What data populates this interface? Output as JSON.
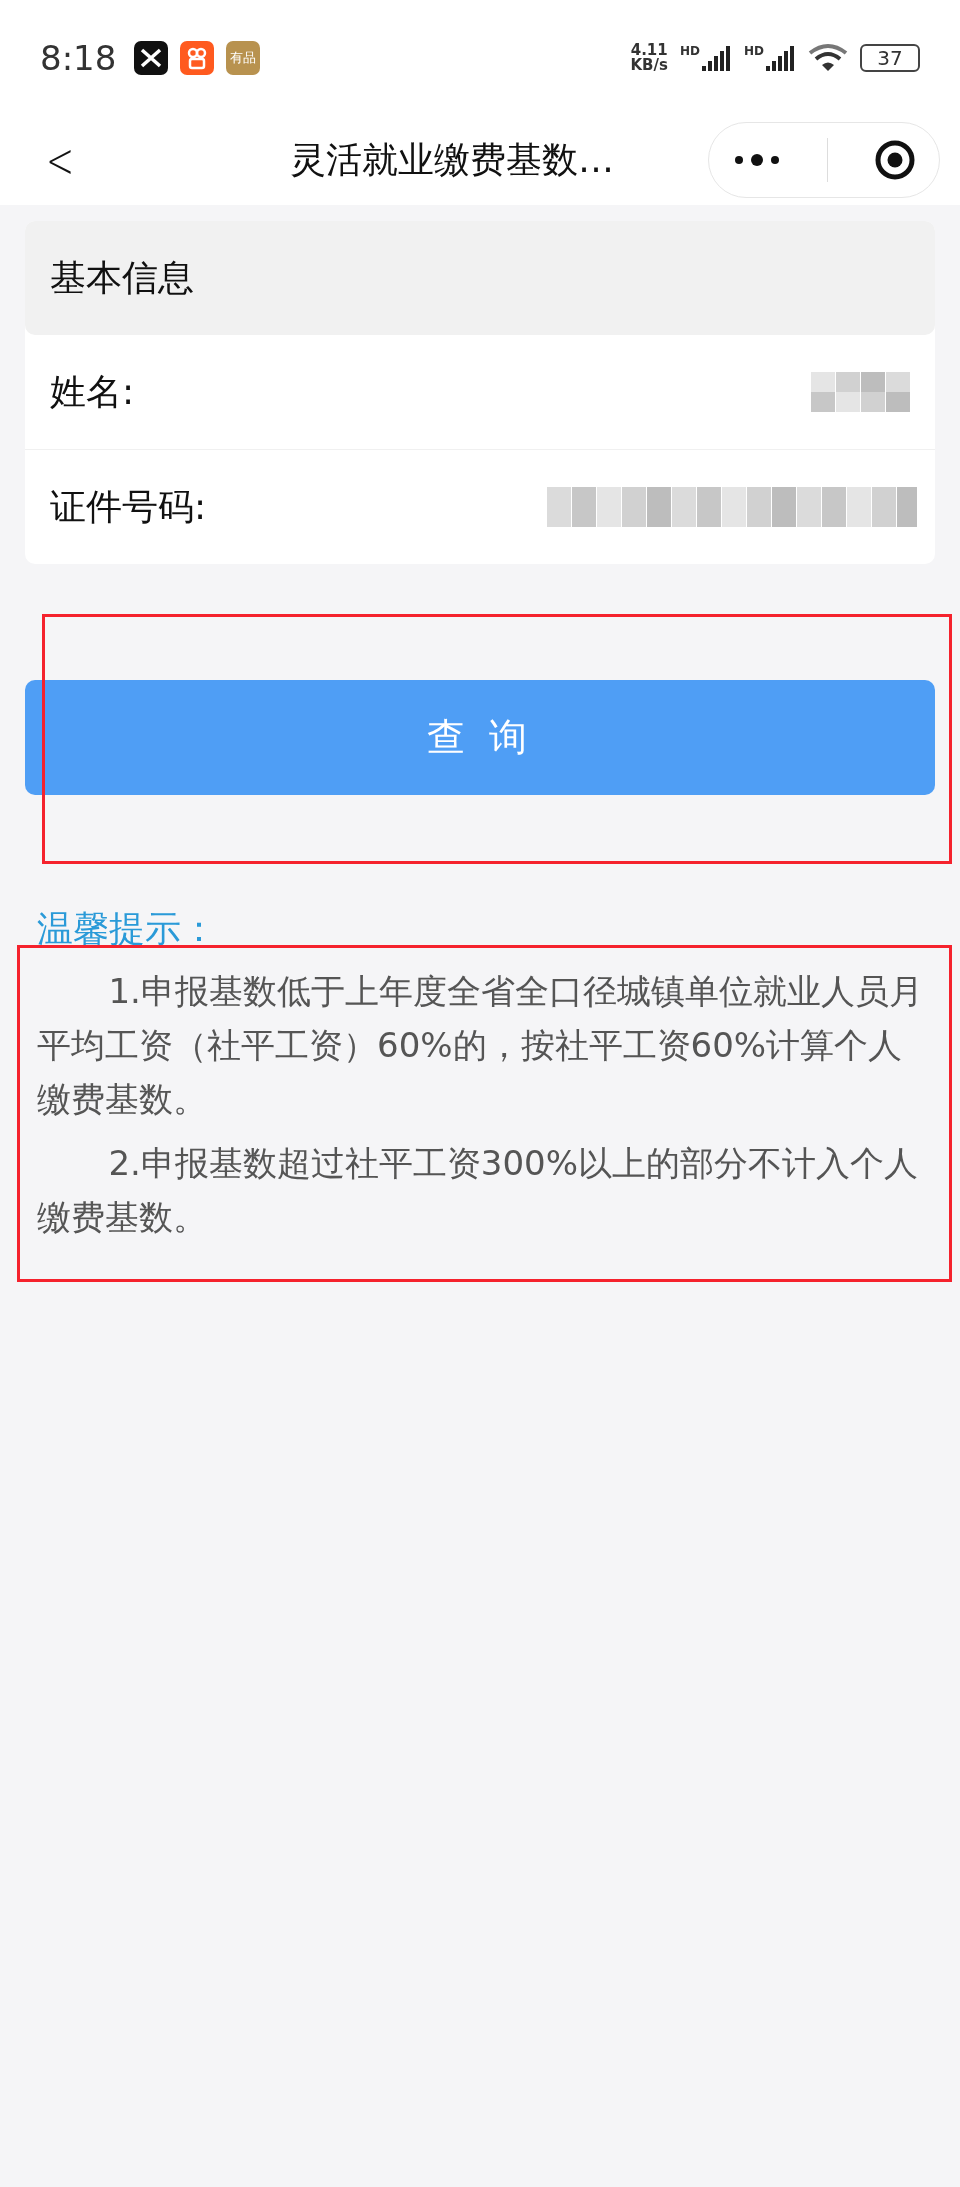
{
  "status_bar": {
    "time": "8:18",
    "app_badge": "有品",
    "net_speed": "4.11",
    "net_unit": "KB/s",
    "signal_labels": [
      "HD",
      "HD"
    ],
    "battery": "37"
  },
  "nav": {
    "back": "<",
    "title": "灵活就业缴费基数…"
  },
  "info_card": {
    "title": "基本信息",
    "fields": [
      {
        "label": "姓名:",
        "kind": "redacted"
      },
      {
        "label": "证件号码:",
        "kind": "redacted"
      }
    ]
  },
  "query_button": "查 询",
  "tips": {
    "title": "温馨提示：",
    "items": [
      "1.申报基数低于上年度全省全口径城镇单位就业人员月平均工资（社平工资）60%的，按社平工资60%计算个人缴费基数。",
      "2.申报基数超过社平工资300%以上的部分不计入个人缴费基数。"
    ]
  },
  "annotations": [
    {
      "kind": "highlight-box",
      "color": "#f5222d"
    },
    {
      "kind": "highlight-box",
      "color": "#f5222d"
    }
  ]
}
